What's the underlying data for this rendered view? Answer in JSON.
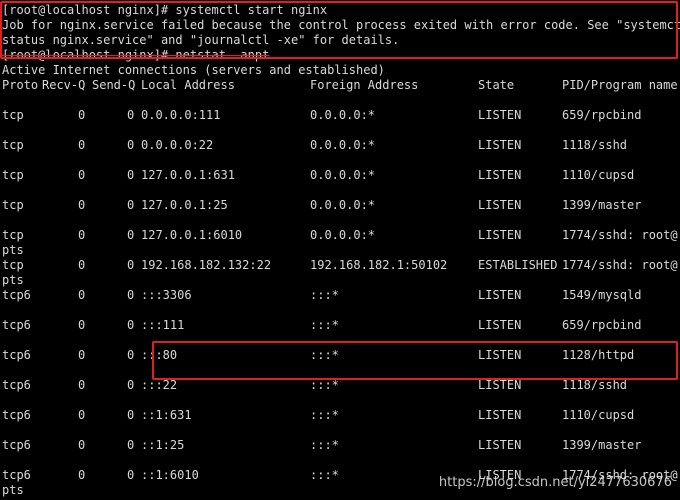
{
  "terminal": {
    "lines": [
      "[root@localhost nginx]# systemctl start nginx",
      "Job for nginx.service failed because the control process exited with error code. See \"systemctl",
      "status nginx.service\" and \"journalctl -xe\" for details.",
      "[root@localhost nginx]# netstat -anpt",
      "Active Internet connections (servers and established)"
    ],
    "header": {
      "proto": "Proto",
      "recvq": "Recv-Q",
      "sendq": "Send-Q",
      "local": "Local Address",
      "foreign": "Foreign Address",
      "state": "State",
      "pid": "PID/Program name"
    },
    "rows": [
      {
        "proto": "tcp",
        "recvq": "0",
        "sendq": "0",
        "local": "0.0.0.0:111",
        "foreign": "0.0.0.0:*",
        "state": "LISTEN",
        "pid": "659/rpcbind",
        "extra": ""
      },
      {
        "proto": "tcp",
        "recvq": "0",
        "sendq": "0",
        "local": "0.0.0.0:22",
        "foreign": "0.0.0.0:*",
        "state": "LISTEN",
        "pid": "1118/sshd",
        "extra": ""
      },
      {
        "proto": "tcp",
        "recvq": "0",
        "sendq": "0",
        "local": "127.0.0.1:631",
        "foreign": "0.0.0.0:*",
        "state": "LISTEN",
        "pid": "1110/cupsd",
        "extra": ""
      },
      {
        "proto": "tcp",
        "recvq": "0",
        "sendq": "0",
        "local": "127.0.0.1:25",
        "foreign": "0.0.0.0:*",
        "state": "LISTEN",
        "pid": "1399/master",
        "extra": ""
      },
      {
        "proto": "tcp",
        "recvq": "0",
        "sendq": "0",
        "local": "127.0.0.1:6010",
        "foreign": "0.0.0.0:*",
        "state": "LISTEN",
        "pid": "1774/sshd: root@",
        "extra": "pts"
      },
      {
        "proto": "tcp",
        "recvq": "0",
        "sendq": "0",
        "local": "192.168.182.132:22",
        "foreign": "192.168.182.1:50102",
        "state": "ESTABLISHED",
        "pid": "1774/sshd: root@",
        "extra": "pts"
      },
      {
        "proto": "tcp6",
        "recvq": "0",
        "sendq": "0",
        "local": ":::3306",
        "foreign": ":::*",
        "state": "LISTEN",
        "pid": "1549/mysqld",
        "extra": ""
      },
      {
        "proto": "tcp6",
        "recvq": "0",
        "sendq": "0",
        "local": ":::111",
        "foreign": ":::*",
        "state": "LISTEN",
        "pid": "659/rpcbind",
        "extra": ""
      },
      {
        "proto": "tcp6",
        "recvq": "0",
        "sendq": "0",
        "local": ":::80",
        "foreign": ":::*",
        "state": "LISTEN",
        "pid": "1128/httpd",
        "extra": ""
      },
      {
        "proto": "tcp6",
        "recvq": "0",
        "sendq": "0",
        "local": ":::22",
        "foreign": ":::*",
        "state": "LISTEN",
        "pid": "1118/sshd",
        "extra": ""
      },
      {
        "proto": "tcp6",
        "recvq": "0",
        "sendq": "0",
        "local": "::1:631",
        "foreign": ":::*",
        "state": "LISTEN",
        "pid": "1110/cupsd",
        "extra": ""
      },
      {
        "proto": "tcp6",
        "recvq": "0",
        "sendq": "0",
        "local": "::1:25",
        "foreign": ":::*",
        "state": "LISTEN",
        "pid": "1399/master",
        "extra": ""
      },
      {
        "proto": "tcp6",
        "recvq": "0",
        "sendq": "0",
        "local": "::1:6010",
        "foreign": ":::*",
        "state": "LISTEN",
        "pid": "1774/sshd: root@",
        "extra": "pts"
      }
    ]
  },
  "watermark": "https://blog.csdn.net/yl2477630676",
  "colors": {
    "text": "#d9d9d9",
    "background": "#000000",
    "highlight": "#e0201e"
  }
}
